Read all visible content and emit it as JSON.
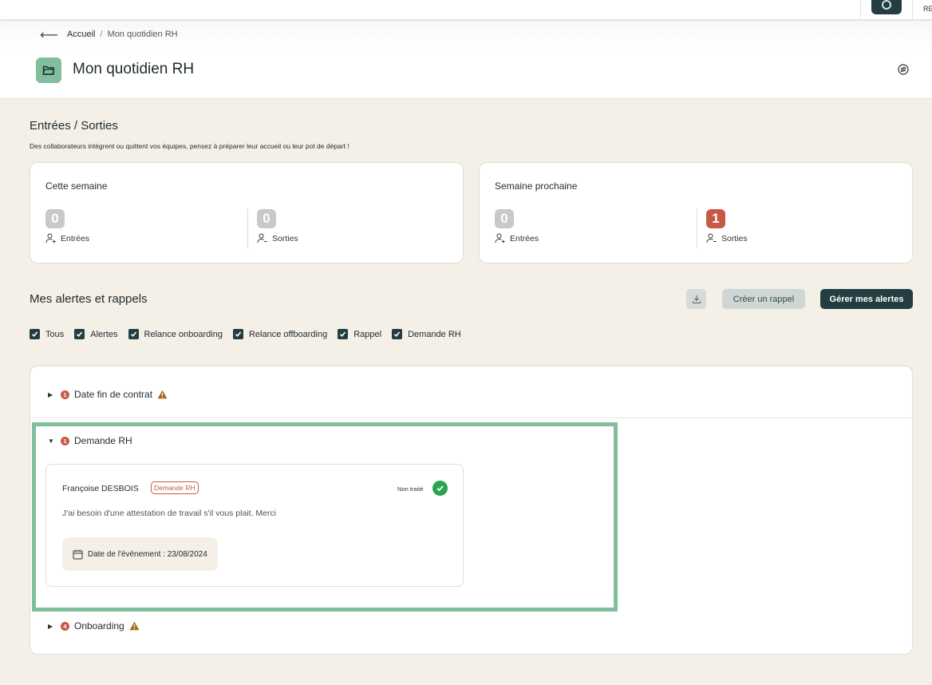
{
  "topbar": {
    "user_initials": "RE"
  },
  "breadcrumb": {
    "home": "Accueil",
    "separator": "/",
    "current": "Mon quotidien RH"
  },
  "page": {
    "title": "Mon quotidien RH"
  },
  "entries_exits": {
    "title": "Entrées / Sorties",
    "subtitle": "Des collaborateurs intègrent ou quittent vos équipes, pensez à préparer leur accueil ou leur pot de départ !",
    "this_week": {
      "title": "Cette semaine",
      "entries_count": "0",
      "entries_label": "Entrées",
      "exits_count": "0",
      "exits_label": "Sorties"
    },
    "next_week": {
      "title": "Semaine prochaine",
      "entries_count": "0",
      "entries_label": "Entrées",
      "exits_count": "1",
      "exits_label": "Sorties"
    }
  },
  "alerts": {
    "title": "Mes alertes et rappels",
    "create_reminder_label": "Créer un rappel",
    "manage_alerts_label": "Gérer mes alertes",
    "filters": [
      "Tous",
      "Alertes",
      "Relance onboarding",
      "Relance offboarding",
      "Rappel",
      "Demande RH"
    ],
    "groups": [
      {
        "label": "Date fin de contrat",
        "count": "1",
        "expanded": false,
        "warning": true
      },
      {
        "label": "Demande RH",
        "count": "1",
        "expanded": true,
        "warning": false
      },
      {
        "label": "Onboarding",
        "count": "4",
        "expanded": false,
        "warning": true
      }
    ],
    "request": {
      "name": "Françoise DESBOIS",
      "tag": "Demande RH",
      "status": "Non traité",
      "message": "J'ai besoin d'une attestation de travail s'il vous plait. Merci",
      "date": "Date de l'évènement : 23/08/2024"
    }
  },
  "colors": {
    "accent_dark": "#233d42",
    "accent_green": "#7fbf9d",
    "badge_red": "#c85a45",
    "background": "#f4efe7"
  }
}
